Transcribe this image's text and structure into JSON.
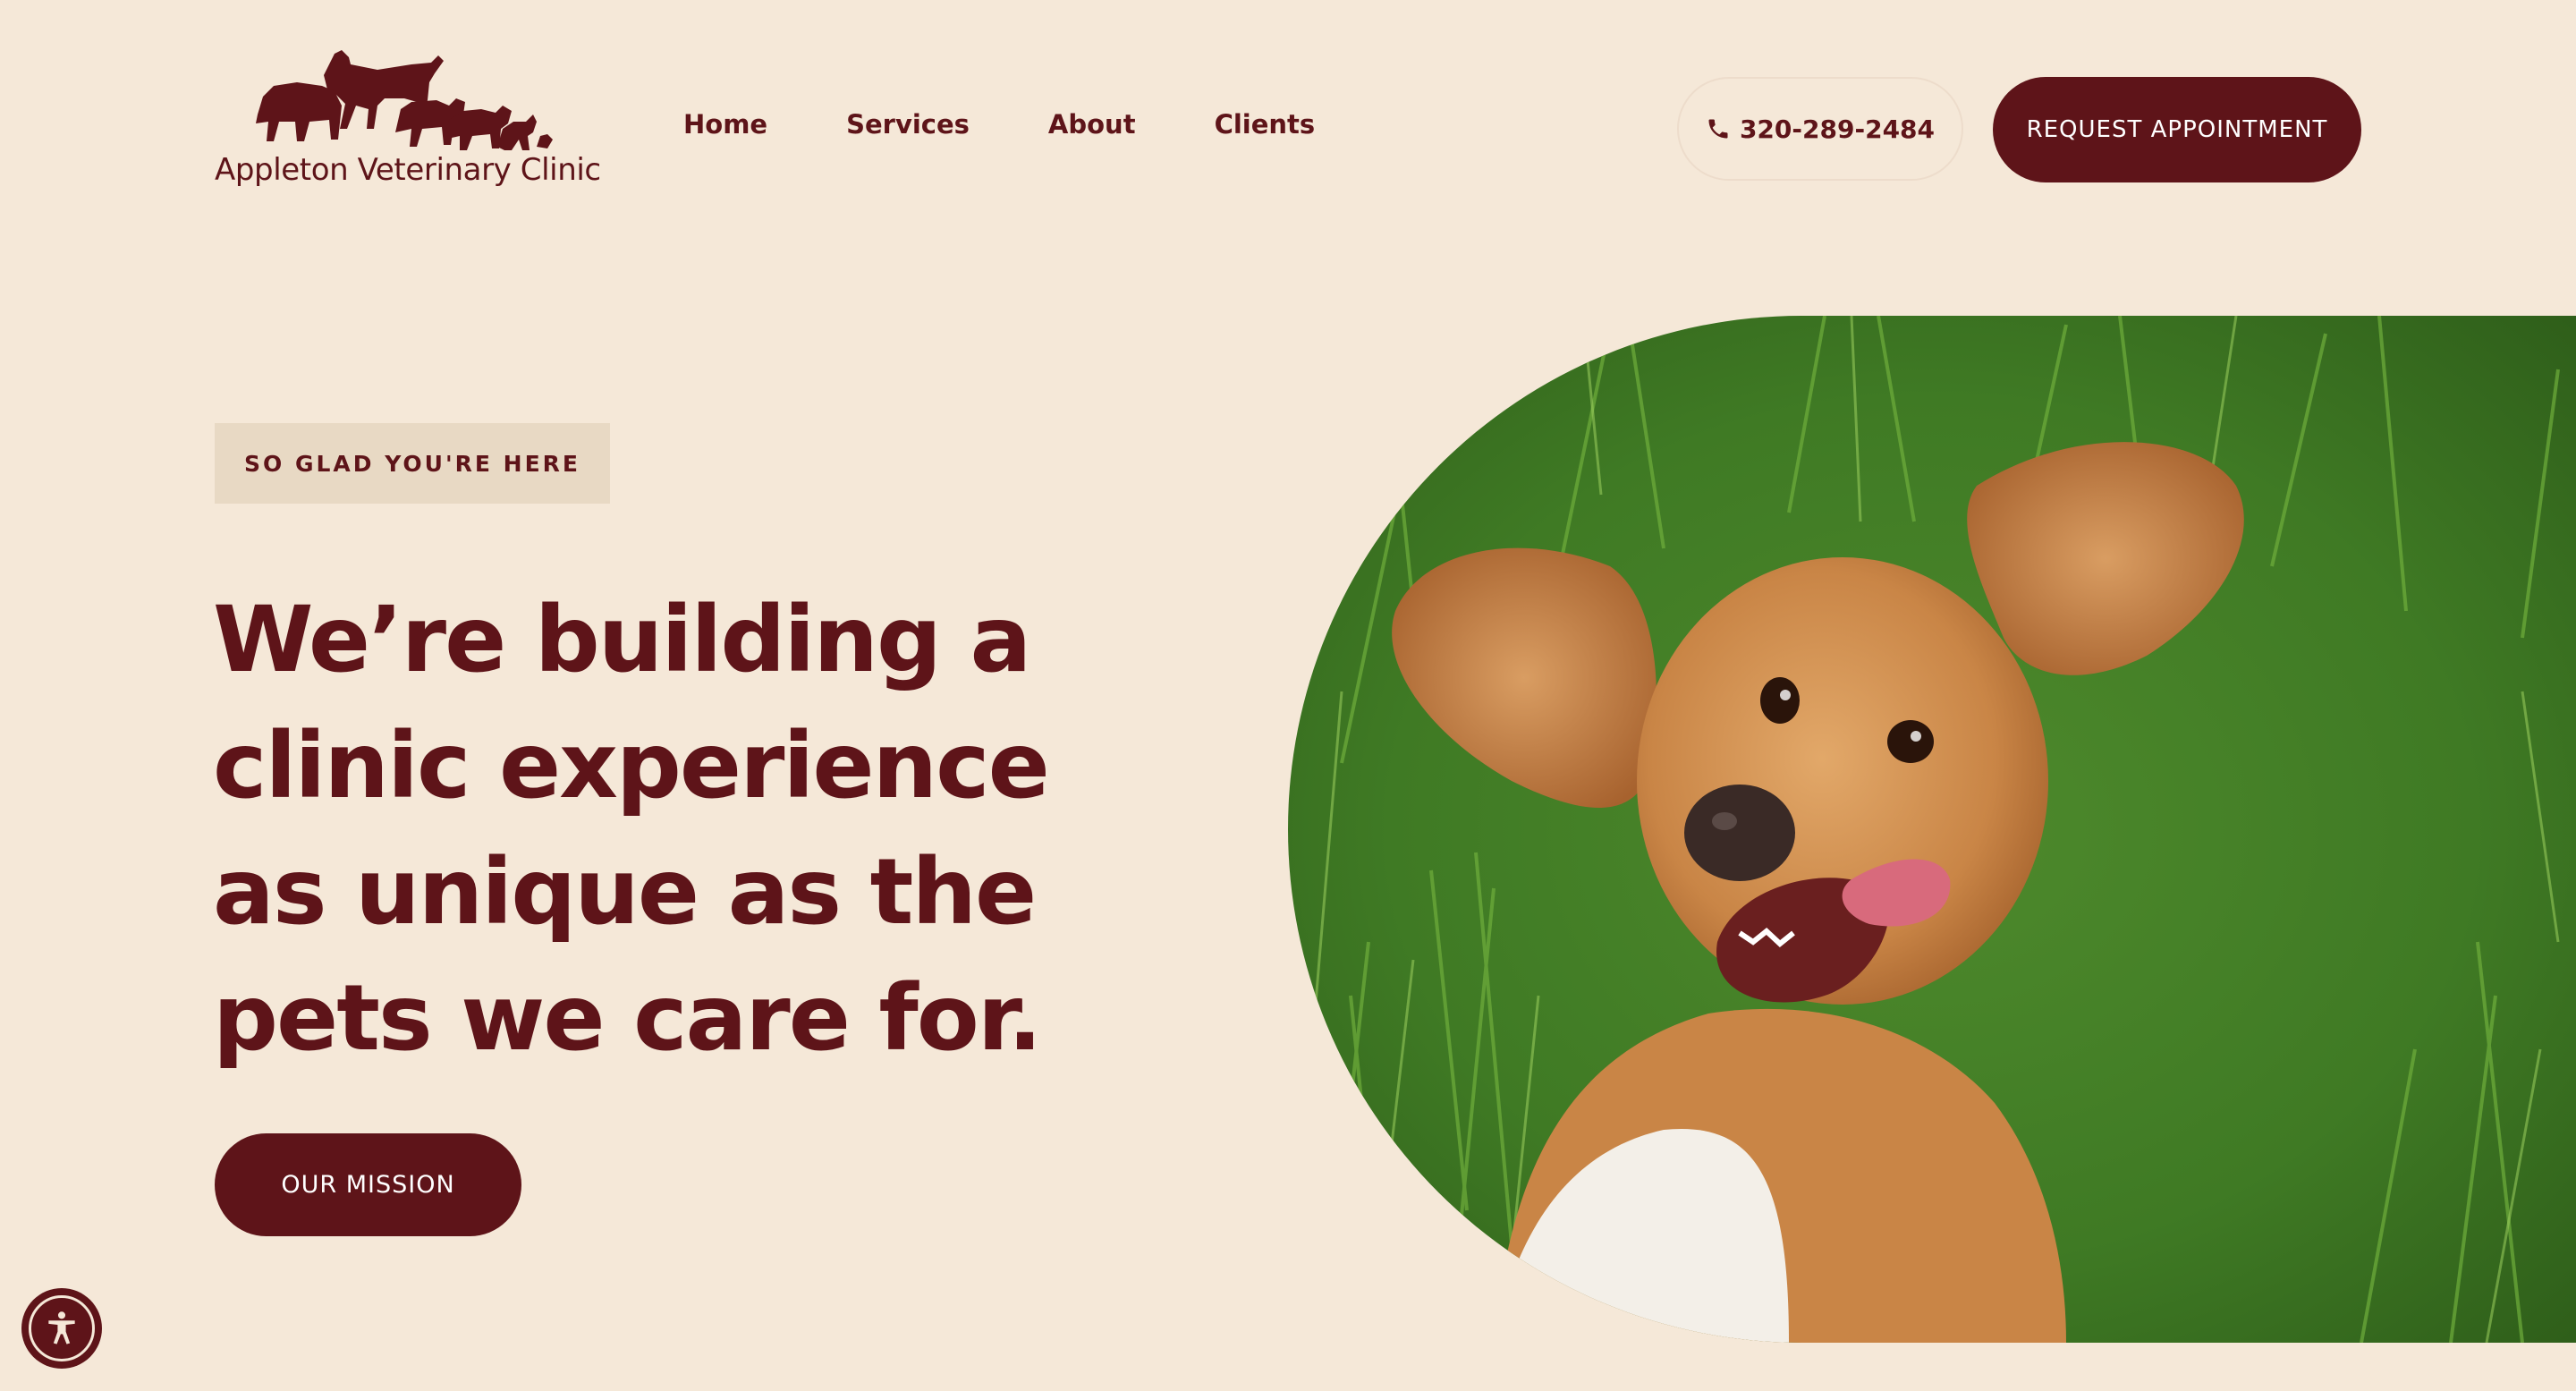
{
  "colors": {
    "background": "#f5e8d8",
    "brand": "#5e1419",
    "tag_bg": "#e8d9c4",
    "button_text": "#ffffff"
  },
  "header": {
    "logo_text": "Appleton Veterinary Clinic",
    "logo_icon": "animals-silhouette-logo",
    "nav": [
      {
        "label": "Home"
      },
      {
        "label": "Services"
      },
      {
        "label": "About"
      },
      {
        "label": "Clients"
      }
    ],
    "phone": {
      "icon": "phone-icon",
      "number": "320-289-2484"
    },
    "cta_label": "REQUEST APPOINTMENT"
  },
  "hero": {
    "eyebrow": "SO GLAD YOU'RE HERE",
    "headline": "We’re building a clinic experience as unique as the pets we care for.",
    "button_label": "OUR MISSION",
    "image": "dog-lying-in-grass-photo"
  },
  "accessibility": {
    "icon": "accessibility-icon"
  }
}
